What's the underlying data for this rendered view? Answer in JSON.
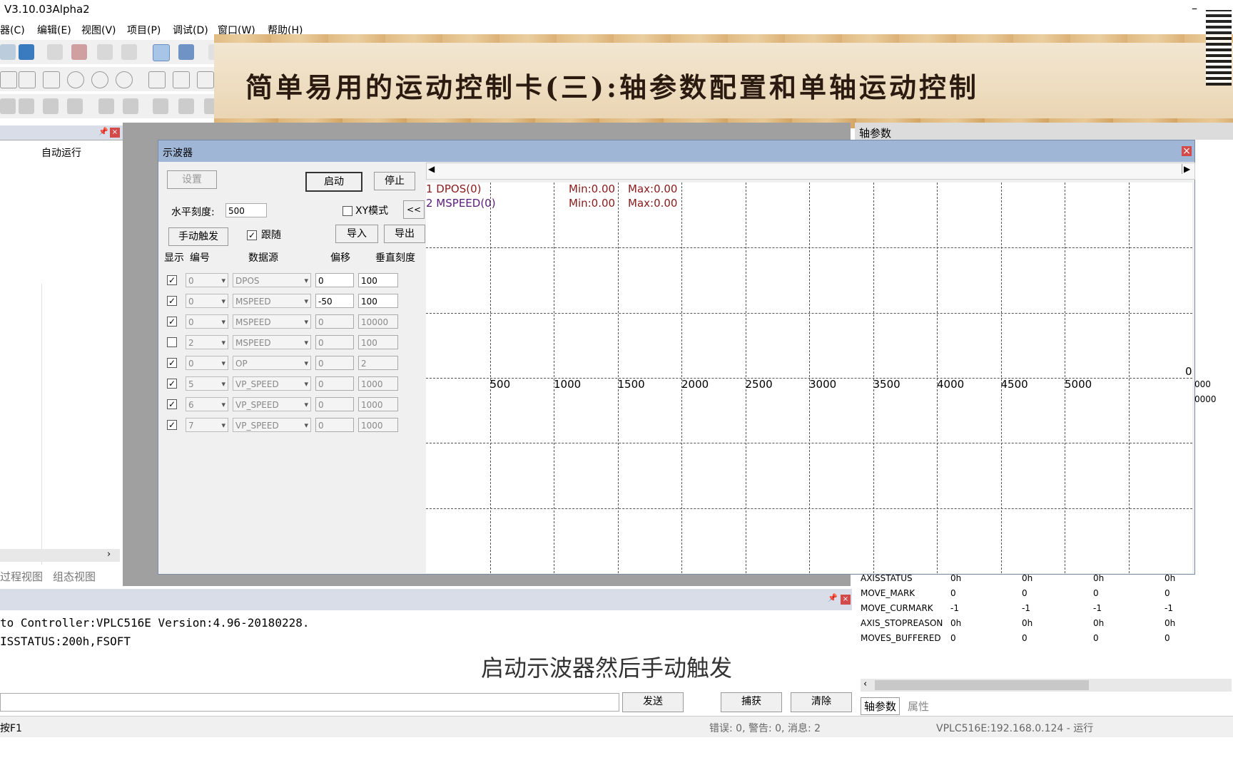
{
  "app": {
    "title": "V3.10.03Alpha2"
  },
  "menu": [
    "器(C)",
    "编辑(E)",
    "视图(V)",
    "项目(P)",
    "调试(D)",
    "窗口(W)",
    "帮助(H)"
  ],
  "banner": {
    "text": "简单易用的运动控制卡(三):轴参数配置和单轴运动控制"
  },
  "left_panel": {
    "column": "自动运行",
    "tabs": [
      "过程视图",
      "组态视图"
    ]
  },
  "osc": {
    "title": "示波器",
    "settings_btn": "设置",
    "start_btn": "启动",
    "stop_btn": "停止",
    "hscale_label": "水平刻度:",
    "hscale_value": "500",
    "xy_label": "XY模式",
    "collapse_btn": "<<",
    "manual_trigger_btn": "手动触发",
    "follow_label": "跟随",
    "import_btn": "导入",
    "export_btn": "导出",
    "headers": {
      "show": "显示",
      "num": "编号",
      "source": "数据源",
      "offset": "偏移",
      "vscale": "垂直刻度"
    },
    "rows": [
      {
        "checked": "✓",
        "num": "0",
        "source": "DPOS",
        "offset": "0",
        "vscale": "100",
        "active": true
      },
      {
        "checked": "✓",
        "num": "0",
        "source": "MSPEED",
        "offset": "-50",
        "vscale": "100",
        "active": true
      },
      {
        "checked": "✓",
        "num": "0",
        "source": "MSPEED",
        "offset": "0",
        "vscale": "10000",
        "active": false
      },
      {
        "checked": "",
        "num": "2",
        "source": "MSPEED",
        "offset": "0",
        "vscale": "100",
        "active": false
      },
      {
        "checked": "✓",
        "num": "0",
        "source": "OP",
        "offset": "0",
        "vscale": "2",
        "active": false
      },
      {
        "checked": "✓",
        "num": "5",
        "source": "VP_SPEED",
        "offset": "0",
        "vscale": "1000",
        "active": false
      },
      {
        "checked": "✓",
        "num": "6",
        "source": "VP_SPEED",
        "offset": "0",
        "vscale": "1000",
        "active": false
      },
      {
        "checked": "✓",
        "num": "7",
        "source": "VP_SPEED",
        "offset": "0",
        "vscale": "1000",
        "active": false
      }
    ],
    "legend": [
      {
        "name": "1 DPOS(0)",
        "min": "Min:0.00",
        "max": "Max:0.00",
        "color": "#8b1a1a"
      },
      {
        "name": "2 MSPEED(0)",
        "min": "Min:0.00",
        "max": "Max:0.00",
        "color": "#5a1a7a"
      }
    ],
    "x_ticks": [
      "500",
      "1000",
      "1500",
      "2000",
      "2500",
      "3000",
      "3500",
      "4000",
      "4500",
      "5000"
    ],
    "zero_label": "0",
    "right_cut": [
      "000",
      "0000"
    ]
  },
  "right_panel": {
    "title": "轴参数",
    "rows": [
      {
        "name": "AXISSTATUS",
        "v": [
          "0h",
          "0h",
          "0h",
          "0h"
        ]
      },
      {
        "name": "MOVE_MARK",
        "v": [
          "0",
          "0",
          "0",
          "0"
        ]
      },
      {
        "name": "MOVE_CURMARK",
        "v": [
          "-1",
          "-1",
          "-1",
          "-1"
        ]
      },
      {
        "name": "AXIS_STOPREASON",
        "v": [
          "0h",
          "0h",
          "0h",
          "0h"
        ]
      },
      {
        "name": "MOVES_BUFFERED",
        "v": [
          "0",
          "0",
          "0",
          "0"
        ]
      }
    ],
    "tabs": [
      "轴参数",
      "属性"
    ]
  },
  "console": {
    "line1": " to Controller:VPLC516E Version:4.96-20180228.",
    "line2": "ISSTATUS:200h,FSOFT",
    "send_btn": "发送",
    "capture_btn": "捕获",
    "clear_btn": "清除"
  },
  "subtitle": "启动示波器然后手动触发",
  "status": {
    "left": "按F1",
    "middle": "错误: 0, 警告: 0, 消息: 2",
    "right": "VPLC516E:192.168.0.124 - 运行"
  }
}
